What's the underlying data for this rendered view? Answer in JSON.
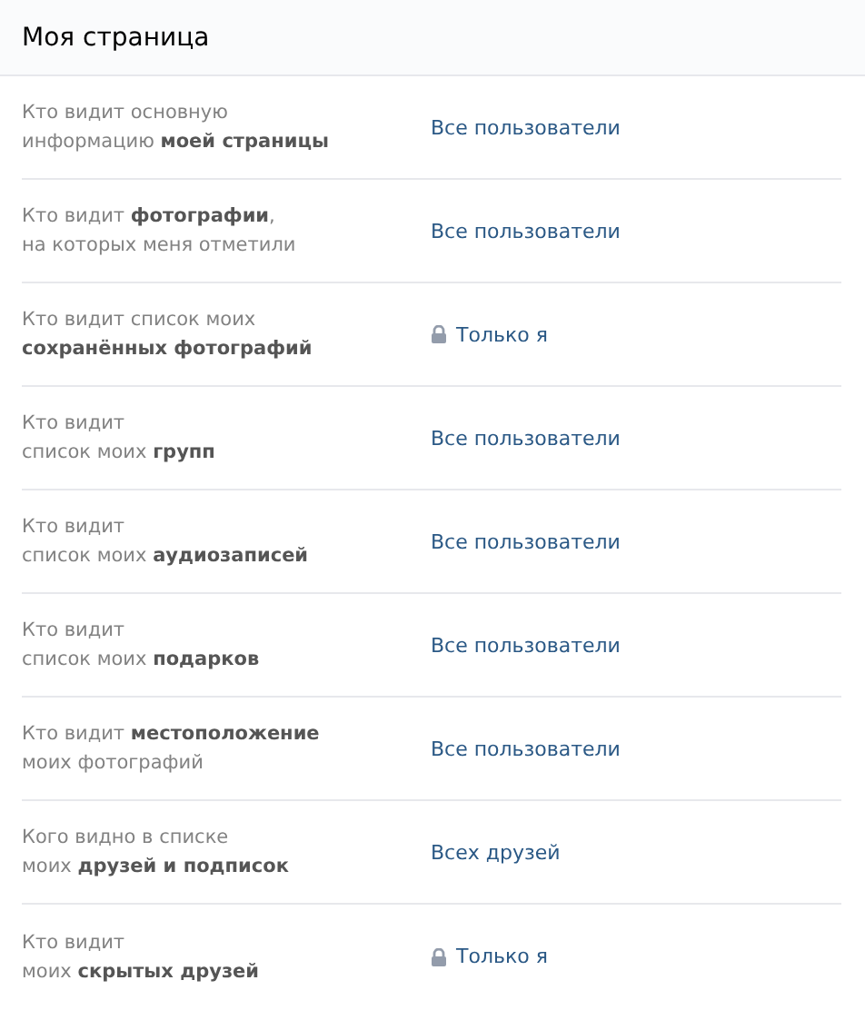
{
  "header": {
    "title": "Моя страница"
  },
  "settings": [
    {
      "label": "Кто видит основную\nинформацию **моей страницы**",
      "value": "Все пользователи",
      "locked": false
    },
    {
      "label": "Кто видит **фотографии**,\nна которых меня отметили",
      "value": "Все пользователи",
      "locked": false
    },
    {
      "label": "Кто видит список моих\n**сохранённых фотографий**",
      "value": "Только я",
      "locked": true
    },
    {
      "label": "Кто видит\nсписок моих **групп**",
      "value": "Все пользователи",
      "locked": false
    },
    {
      "label": "Кто видит\nсписок моих **аудиозаписей**",
      "value": "Все пользователи",
      "locked": false
    },
    {
      "label": "Кто видит\nсписок моих **подарков**",
      "value": "Все пользователи",
      "locked": false
    },
    {
      "label": "Кто видит **местоположение**\nмоих фотографий",
      "value": "Все пользователи",
      "locked": false
    },
    {
      "label": "Кого видно в списке\nмоих **друзей и подписок**",
      "value": "Всех друзей",
      "locked": false
    },
    {
      "label": "Кто видит\nмоих **скрытых друзей**",
      "value": "Только я",
      "locked": true
    }
  ]
}
